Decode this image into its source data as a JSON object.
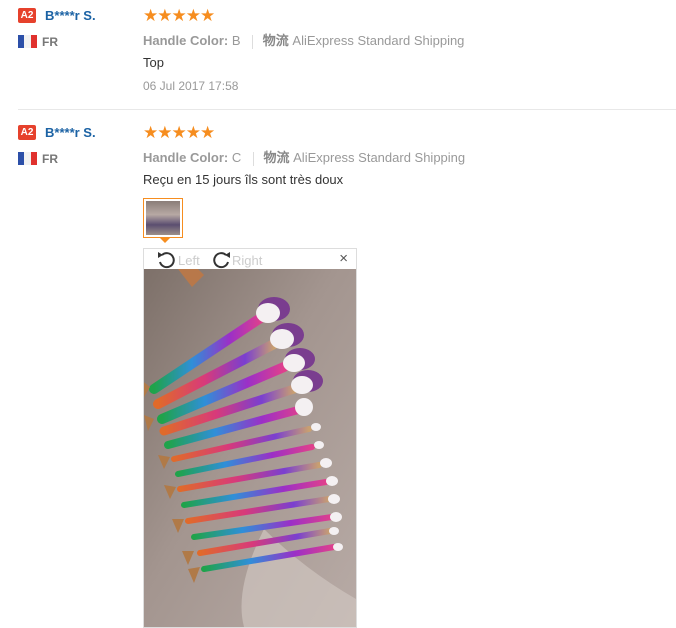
{
  "reviews": [
    {
      "badge": "A2",
      "username": "B****r S.",
      "country": "FR",
      "stars": "★★★★★",
      "option_label": "Handle Color:",
      "option_value": "B",
      "shipping_label": "物流",
      "shipping_value": "AliExpress Standard Shipping",
      "comment": "Top",
      "date": "06 Jul 2017 17:58"
    },
    {
      "badge": "A2",
      "username": "B****r S.",
      "country": "FR",
      "stars": "★★★★★",
      "option_label": "Handle Color:",
      "option_value": "C",
      "shipping_label": "物流",
      "shipping_value": "AliExpress Standard Shipping",
      "comment": "Reçu en 15 jours îls sont très doux"
    }
  ],
  "viewer": {
    "rotate_left": "Left",
    "rotate_right": "Right",
    "close": "×"
  },
  "colors": {
    "accent": "#f68d1f",
    "username": "#1b62a4",
    "badge": "#e6412c"
  }
}
